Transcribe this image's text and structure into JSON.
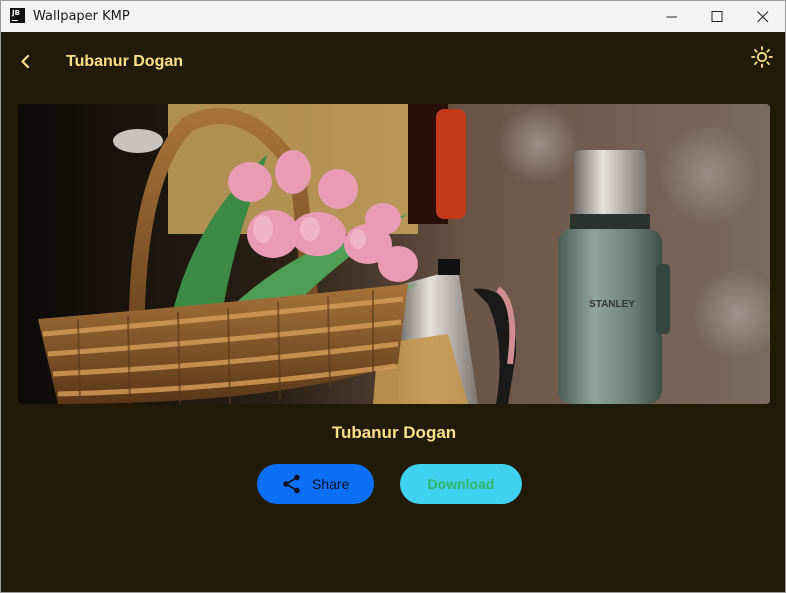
{
  "window": {
    "title": "Wallpaper KMP",
    "logo_text": "JB",
    "controls": [
      "minimize-icon",
      "maximize-icon",
      "close-icon"
    ]
  },
  "header": {
    "back_icon": "chevron-left-icon",
    "title": "Tubanur Dogan",
    "theme_icon": "sun-icon"
  },
  "photo": {
    "description_icon": "wallpaper-photo"
  },
  "author": {
    "name": "Tubanur Dogan"
  },
  "actions": {
    "share_label": "Share",
    "share_icon": "share-icon",
    "download_label": "Download"
  },
  "colors": {
    "background": "#211a06",
    "accent_text": "#ffe08a",
    "share_button": "#0b6ff7",
    "download_button": "#40d0f0",
    "download_text": "#2fb86a"
  }
}
